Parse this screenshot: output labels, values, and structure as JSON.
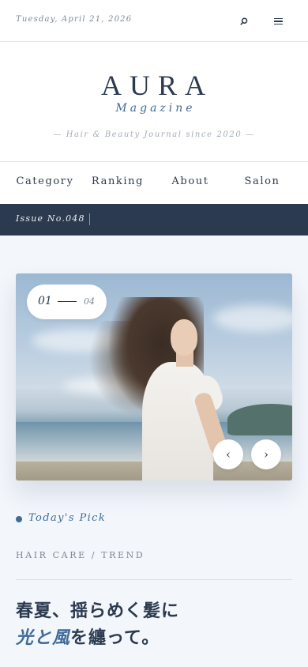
{
  "header": {
    "date": "Tuesday, April 21, 2026",
    "search_icon": "search-icon",
    "menu_icon": "hamburger-menu-icon"
  },
  "brand": {
    "logo": "AURA",
    "sublogo": "Magazine",
    "tagline": "— Hair & Beauty Journal since 2020 —"
  },
  "nav": {
    "items": [
      {
        "label": "Category"
      },
      {
        "label": "Ranking"
      },
      {
        "label": "About"
      },
      {
        "label": "Salon"
      }
    ]
  },
  "issue": {
    "label": "Issue No.048"
  },
  "hero": {
    "current": "01",
    "total": "04",
    "prev_icon": "chevron-left-icon",
    "prev_glyph": "‹",
    "next_icon": "chevron-right-icon",
    "next_glyph": "›"
  },
  "article": {
    "pick_label": "Today's Pick",
    "tags": "HAIR CARE / TREND",
    "headline_line1": "春夏、揺らめく髪に",
    "headline_accent": "光と風",
    "headline_line2_rest": "を纏って。"
  },
  "colors": {
    "navy": "#2c3a4f",
    "accent_blue": "#3f6a9a",
    "background": "#f3f6fb"
  }
}
